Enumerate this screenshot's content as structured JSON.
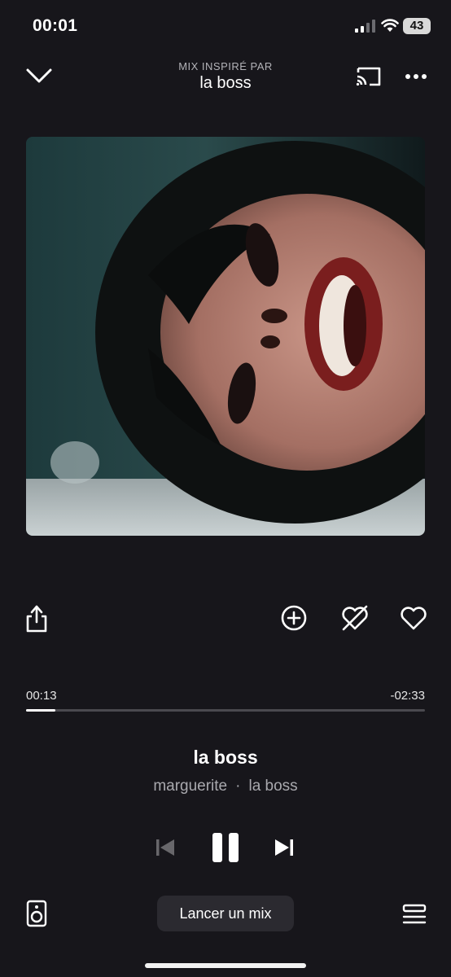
{
  "status_bar": {
    "time": "00:01",
    "battery": "43",
    "icons": [
      "signal-icon",
      "wifi-icon",
      "battery-icon"
    ]
  },
  "header": {
    "subtitle": "MIX INSPIRÉ PAR",
    "title": "la boss",
    "icons": [
      "chevron-down-icon",
      "cast-icon",
      "more-icon"
    ]
  },
  "actions": {
    "icons": [
      "share-icon",
      "add-icon",
      "dislike-icon",
      "heart-icon"
    ]
  },
  "progress": {
    "elapsed": "00:13",
    "remaining": "-02:33",
    "fraction": 0.074
  },
  "track": {
    "title": "la boss",
    "artist": "marguerite",
    "separator": "·",
    "album": "la boss"
  },
  "controls": {
    "icons": [
      "previous-icon",
      "pause-icon",
      "next-icon"
    ]
  },
  "bottom": {
    "mix_label": "Lancer un mix",
    "icons": [
      "speaker-icon",
      "queue-icon"
    ]
  },
  "colors": {
    "background": "#17161b",
    "text": "#ffffff",
    "muted": "#a9a9ae",
    "track": "#4a494f",
    "button_bg": "#2b2a30"
  }
}
